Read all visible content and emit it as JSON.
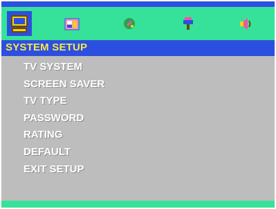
{
  "header": {
    "title": "SYSTEM SETUP"
  },
  "menu": {
    "items": [
      "TV SYSTEM",
      "SCREEN SAVER",
      "TV TYPE",
      "PASSWORD",
      "RATING",
      "DEFAULT",
      "EXIT SETUP"
    ]
  },
  "icons": [
    "system-setup-icon",
    "language-setup-icon",
    "audio-setup-icon",
    "video-setup-icon",
    "speaker-setup-icon"
  ],
  "colors": {
    "blue": "#2d4fe0",
    "green": "#36e29a",
    "gray": "#bdbdbd",
    "yellow": "#f7e84a"
  }
}
